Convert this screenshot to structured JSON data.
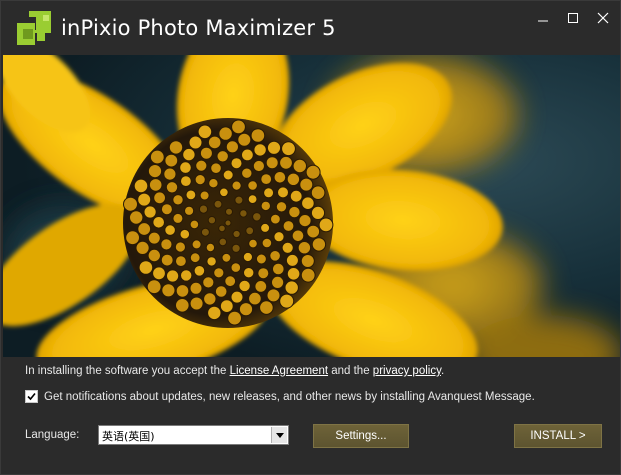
{
  "window": {
    "title": "inPixio Photo Maximizer 5",
    "controls": {
      "minimize": "minimize-icon",
      "maximize": "maximize-icon",
      "close": "close-icon"
    }
  },
  "legal": {
    "prefix": "In installing the software you accept the ",
    "license_link": "License Agreement",
    "middle": " and the ",
    "privacy_link": "privacy policy",
    "suffix": "."
  },
  "notifications": {
    "checked": true,
    "label": "Get notifications about updates, new releases, and other news by installing Avanquest Message."
  },
  "language": {
    "label": "Language:",
    "selected": "英语(英国)"
  },
  "buttons": {
    "settings": "Settings...",
    "install": "INSTALL >"
  },
  "colors": {
    "background": "#2b2b2b",
    "logo_green": "#9acd32",
    "button": "#655b33",
    "flower_yellow": "#f2b807"
  }
}
